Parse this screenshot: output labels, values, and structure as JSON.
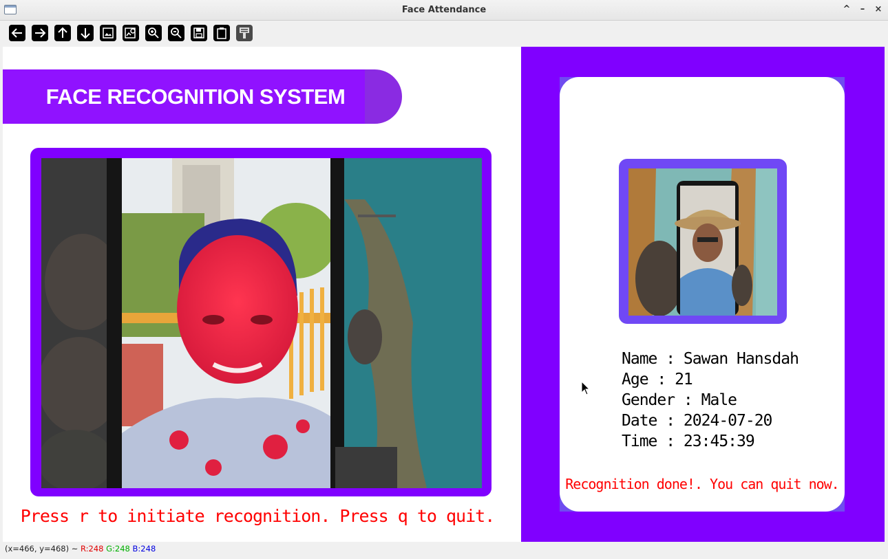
{
  "window": {
    "title": "Face Attendance",
    "controls": [
      "^",
      "–",
      "×"
    ]
  },
  "toolbar": {
    "buttons": [
      {
        "name": "pan-left",
        "icon": "arrow-left-icon"
      },
      {
        "name": "pan-right",
        "icon": "arrow-right-icon"
      },
      {
        "name": "pan-up",
        "icon": "arrow-up-icon"
      },
      {
        "name": "pan-down",
        "icon": "arrow-down-icon"
      },
      {
        "name": "zoom-original",
        "icon": "image-icon"
      },
      {
        "name": "zoom-fit",
        "icon": "image-search-icon"
      },
      {
        "name": "zoom-in",
        "icon": "zoom-in-icon"
      },
      {
        "name": "zoom-out",
        "icon": "zoom-out-icon"
      },
      {
        "name": "save",
        "icon": "save-icon"
      },
      {
        "name": "copy-clipboard",
        "icon": "clipboard-icon"
      },
      {
        "name": "properties",
        "icon": "properties-icon"
      }
    ]
  },
  "app": {
    "banner_title": "FACE RECOGNITION SYSTEM",
    "instruction": "Press r to initiate recognition. Press q to quit.",
    "accent_color": "#8000ff",
    "instruction_color": "#ff0000"
  },
  "card": {
    "name_line": "Name : Sawan Hansdah",
    "age_line": "Age : 21",
    "gender_line": "Gender : Male",
    "date_line": "Date : 2024-07-20",
    "time_line": "Time : 23:45:39",
    "status_message": "Recognition done!. You can quit now."
  },
  "statusbar": {
    "coords": "(x=466, y=468) ~",
    "r": "R:248",
    "g": "G:248",
    "b": "B:248"
  }
}
